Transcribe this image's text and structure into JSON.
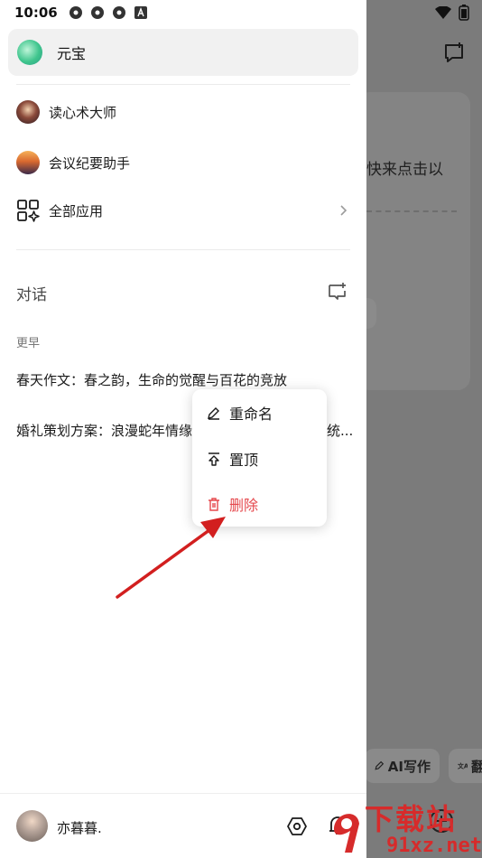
{
  "status_bar": {
    "time": "10:06"
  },
  "drawer": {
    "pinned_app": {
      "label": "元宝"
    },
    "apps": [
      {
        "label": "读心术大师"
      },
      {
        "label": "会议纪要助手"
      },
      {
        "label": "全部应用"
      }
    ],
    "section_title": "对话",
    "group_label": "更早",
    "conversations": [
      {
        "title": "春天作文：春之韵，生命的觉醒与百花的竞放"
      },
      {
        "title": "婚礼策划方案：浪漫蛇年情缘"
      },
      {
        "title_tail": "统..."
      }
    ]
  },
  "context_menu": {
    "items": [
      {
        "label": "重命名",
        "icon": "edit-icon"
      },
      {
        "label": "置顶",
        "icon": "pin-top-icon"
      },
      {
        "label": "删除",
        "icon": "trash-icon",
        "color": "#e5484d"
      }
    ]
  },
  "user": {
    "name": "亦暮暮."
  },
  "background": {
    "snippet": "快来点击以",
    "chips": [
      {
        "label": "AI写作"
      },
      {
        "label": "翻"
      }
    ]
  },
  "watermark": {
    "big": "下载站",
    "small": "91xz.net"
  },
  "colors": {
    "accent_red": "#e5484d",
    "annotation_arrow": "#d21f1f"
  }
}
